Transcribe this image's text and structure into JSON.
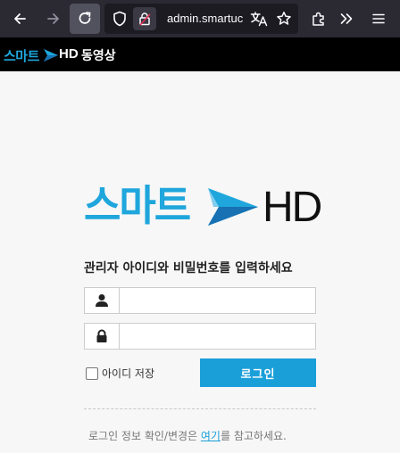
{
  "browser": {
    "url": "admin.smartuc",
    "icons": [
      "back-icon",
      "forward-icon",
      "reload-icon",
      "shield-icon",
      "lock-icon",
      "translate-icon",
      "bookmark-star-icon",
      "extensions-icon",
      "overflow-icon",
      "menu-icon"
    ],
    "colors": {
      "toolbar": "#2b2a33",
      "urlbar": "#1c1b22"
    }
  },
  "header": {
    "logo_text": "스마트",
    "logo_suffix": "HD",
    "title": "동영상"
  },
  "login": {
    "logo_text": "스마트",
    "logo_suffix": "HD",
    "prompt": "관리자 아이디와 비밀번호를 입력하세요",
    "id_field": {
      "value": "",
      "placeholder": "",
      "icon": "user-icon"
    },
    "password_field": {
      "value": "",
      "placeholder": "",
      "icon": "lock-icon"
    },
    "remember_label": "아이디 저장",
    "remember_checked": false,
    "submit_label": "로그인",
    "help_prefix": "로그인 정보 확인/변경은 ",
    "help_link": "여기",
    "help_suffix": "를 참고하세요."
  },
  "colors": {
    "brand_blue": "#1fa6dc",
    "button_blue": "#1b9fd9",
    "header_bg": "#000000",
    "page_bg": "#f7f7f7"
  }
}
